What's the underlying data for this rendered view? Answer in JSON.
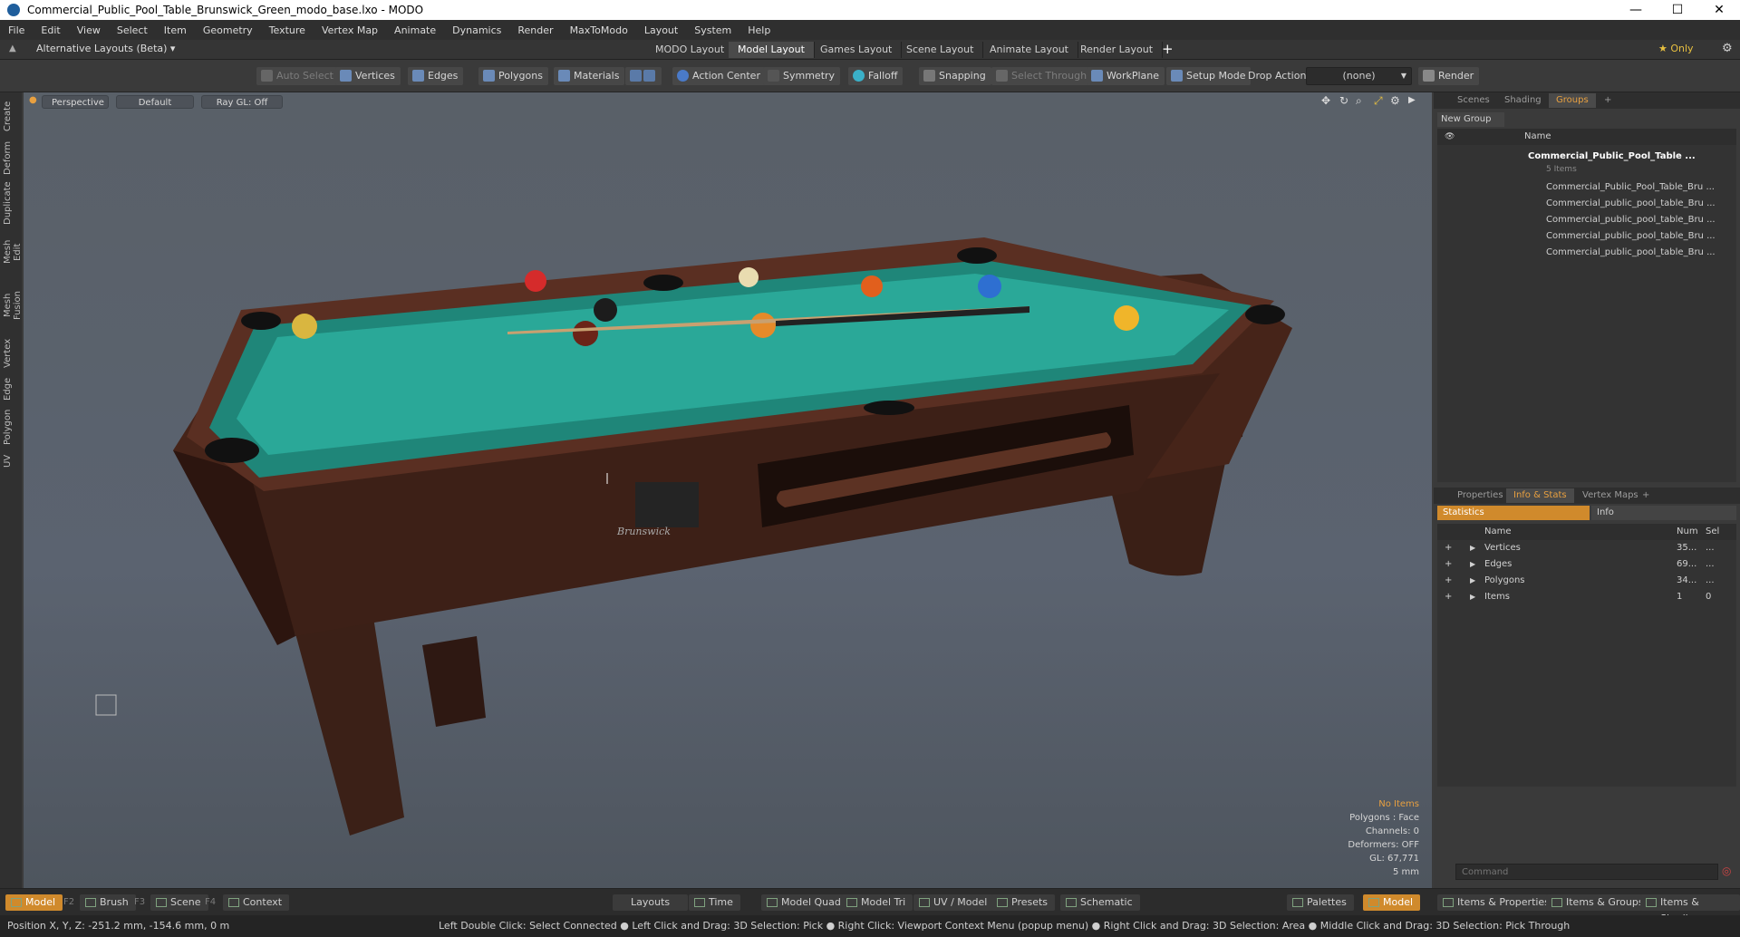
{
  "window": {
    "title": "Commercial_Public_Pool_Table_Brunswick_Green_modo_base.lxo - MODO",
    "minimize": "—",
    "maximize": "☐",
    "close": "✕"
  },
  "menu": [
    "File",
    "Edit",
    "View",
    "Select",
    "Item",
    "Geometry",
    "Texture",
    "Vertex Map",
    "Animate",
    "Dynamics",
    "Render",
    "MaxToModo",
    "Layout",
    "System",
    "Help"
  ],
  "layout_bar": {
    "alt_layouts": "Alternative Layouts (Beta) ▾",
    "tabs": [
      "MODO Layout",
      "Model Layout",
      "Games Layout",
      "Scene Layout",
      "Animate Layout",
      "Render Layout"
    ],
    "active_tab": "Model Layout",
    "add": "+",
    "only": "★ Only",
    "gear": "⚙"
  },
  "toolbar": {
    "auto_select": "Auto Select",
    "vertices": "Vertices",
    "edges": "Edges",
    "polygons": "Polygons",
    "materials": "Materials",
    "action_center": "Action Center",
    "symmetry": "Symmetry",
    "falloff": "Falloff",
    "snapping": "Snapping",
    "select_through": "Select Through",
    "workplane": "WorkPlane",
    "setup_mode": "Setup Mode",
    "drop_action": "Drop Action",
    "drop_value": "(none)",
    "render": "Render"
  },
  "left_tabs": [
    "Create",
    "Deform",
    "Duplicate",
    "Mesh Edit",
    "Mesh Fusion",
    "Vertex",
    "Edge",
    "Polygon",
    "UV"
  ],
  "viewport": {
    "view": "Perspective",
    "shading": "Default",
    "raygl": "Ray GL: Off",
    "stats": {
      "items": "No Items",
      "polygons": "Polygons : Face",
      "channels": "Channels: 0",
      "deformers": "Deformers: OFF",
      "gl": "GL: 67,771",
      "unit": "5 mm"
    },
    "brand": "Brunswick"
  },
  "scene_panel": {
    "tabs": [
      "Scenes",
      "Shading",
      "Groups"
    ],
    "active_tab": "Groups",
    "add": "+",
    "new_group": "New Group",
    "column_name": "Name",
    "group_name": "Commercial_Public_Pool_Table ...",
    "group_count": "5 Items",
    "children": [
      "Commercial_Public_Pool_Table_Bru ...",
      "Commercial_public_pool_table_Bru ...",
      "Commercial_public_pool_table_Bru ...",
      "Commercial_public_pool_table_Bru ...",
      "Commercial_public_pool_table_Bru ..."
    ]
  },
  "props_panel": {
    "tabs": [
      "Properties",
      "Info & Stats",
      "Vertex Maps"
    ],
    "active_tab": "Info & Stats",
    "add": "+",
    "statistics": "Statistics",
    "info": "Info",
    "col_name": "Name",
    "col_num": "Num",
    "col_sel": "Sel",
    "rows": [
      {
        "name": "Vertices",
        "num": "35...",
        "sel": "..."
      },
      {
        "name": "Edges",
        "num": "69...",
        "sel": "..."
      },
      {
        "name": "Polygons",
        "num": "34...",
        "sel": "..."
      },
      {
        "name": "Items",
        "num": "1",
        "sel": "0"
      }
    ],
    "command_placeholder": "Command"
  },
  "bottom_bar": {
    "model": "Model",
    "model_key": "F2",
    "brush": "Brush",
    "brush_key": "F3",
    "scene": "Scene",
    "scene_key": "F4",
    "context": "Context",
    "layouts": "Layouts",
    "time": "Time",
    "model_quad": "Model Quad",
    "model_tri": "Model Tri",
    "uv_model": "UV / Model",
    "presets": "Presets",
    "schematic": "Schematic",
    "palettes": "Palettes",
    "model_right": "Model",
    "items_props": "Items & Properties",
    "items_groups": "Items & Groups",
    "items_shading": "Items & Shading"
  },
  "status_bar": {
    "position": "Position X, Y, Z:   -251.2 mm, -154.6 mm, 0 m",
    "hints": "Left Double Click: Select Connected ● Left Click and Drag: 3D Selection: Pick ● Right Click: Viewport Context Menu (popup menu) ● Right Click and Drag: 3D Selection: Area ● Middle Click and Drag: 3D Selection: Pick Through"
  },
  "colors": {
    "accent": "#e8a040",
    "felt": "#2aa898",
    "wood": "#4a2a1f",
    "viewport_bg": "#5a616b"
  }
}
